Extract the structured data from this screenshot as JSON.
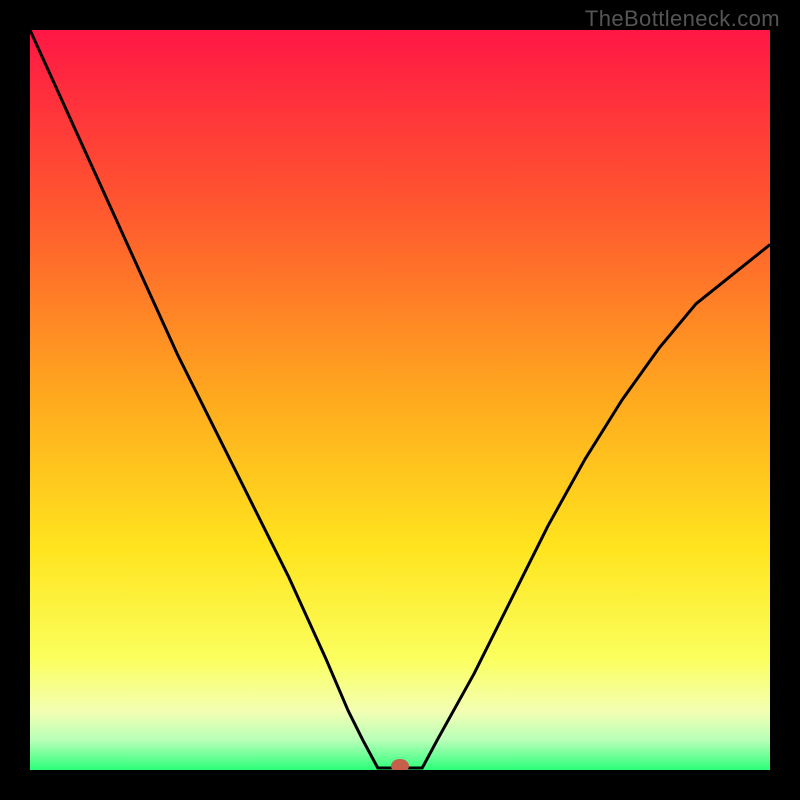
{
  "watermark": "TheBottleneck.com",
  "chart_data": {
    "type": "line",
    "title": "",
    "xlabel": "",
    "ylabel": "",
    "xlim": [
      0,
      100
    ],
    "ylim": [
      0,
      100
    ],
    "grid": false,
    "legend": false,
    "series": [
      {
        "name": "bottleneck-curve",
        "x": [
          0,
          5,
          10,
          15,
          20,
          25,
          30,
          35,
          40,
          43,
          45,
          47,
          49,
          51,
          53,
          55,
          60,
          65,
          70,
          75,
          80,
          85,
          90,
          95,
          100
        ],
        "y": [
          100,
          89,
          78,
          67,
          56,
          46,
          36,
          26,
          15,
          8,
          4,
          1,
          0,
          0,
          1,
          4,
          13,
          23,
          33,
          42,
          50,
          57,
          63,
          67,
          71
        ]
      }
    ],
    "marker": {
      "x": 50,
      "y": 0
    },
    "notch_range_x": [
      47,
      53
    ],
    "gradient_stops": [
      {
        "offset": 0.0,
        "color": "#ff1745"
      },
      {
        "offset": 0.25,
        "color": "#ff5a2e"
      },
      {
        "offset": 0.5,
        "color": "#ffaa1e"
      },
      {
        "offset": 0.7,
        "color": "#ffe41e"
      },
      {
        "offset": 0.85,
        "color": "#fbff5e"
      },
      {
        "offset": 0.92,
        "color": "#f3ffb3"
      },
      {
        "offset": 0.96,
        "color": "#b8ffb8"
      },
      {
        "offset": 1.0,
        "color": "#2bff79"
      }
    ],
    "marker_color": "#c65e4c"
  }
}
